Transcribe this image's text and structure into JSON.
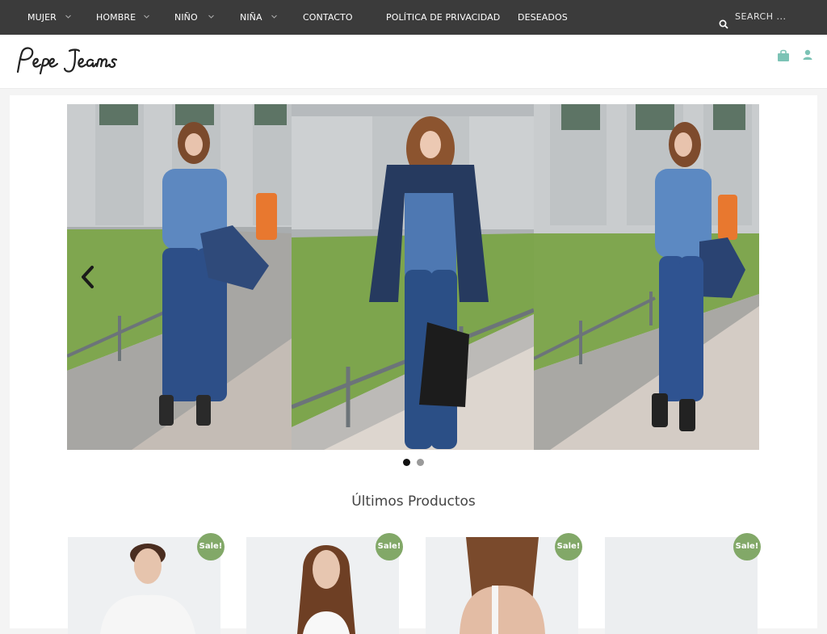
{
  "nav": {
    "items": [
      {
        "label": "MUJER",
        "dropdown": true
      },
      {
        "label": "HOMBRE",
        "dropdown": true
      },
      {
        "label": "NIÑO",
        "dropdown": true
      },
      {
        "label": "NIÑA",
        "dropdown": true
      },
      {
        "label": "CONTACTO",
        "dropdown": false
      },
      {
        "label": "POLÍTICA DE PRIVACIDAD",
        "dropdown": false
      },
      {
        "label": "DESEADOS",
        "dropdown": false
      }
    ],
    "search_placeholder": "SEARCH ..."
  },
  "header": {
    "logo_text": "Pepe Jeans",
    "icons": [
      "shopping-bag-icon",
      "user-icon"
    ]
  },
  "slider": {
    "slide_count": 2,
    "active_slide": 1
  },
  "section": {
    "title": "Últimos Productos"
  },
  "products": [
    {
      "badge": "Sale!"
    },
    {
      "badge": "Sale!"
    },
    {
      "badge": "Sale!"
    },
    {
      "badge": "Sale!"
    }
  ],
  "colors": {
    "topbar": "#3b3b3b",
    "accent": "#7cc3b5",
    "sale_badge": "#82a868"
  }
}
